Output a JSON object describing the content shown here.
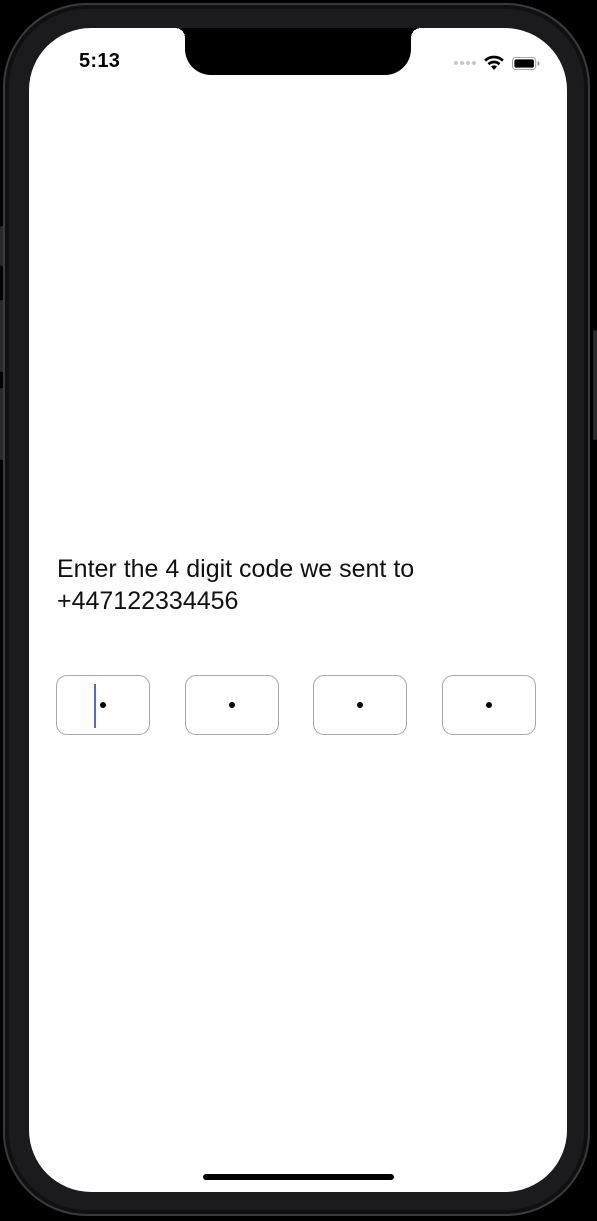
{
  "status_bar": {
    "time": "5:13",
    "icons": [
      "signal-dots-icon",
      "wifi-icon",
      "battery-icon"
    ]
  },
  "verification": {
    "prompt_line1": "Enter the 4 digit code we sent to",
    "phone_number": "+447122334456",
    "code_length": 4,
    "code_placeholder": "•",
    "focused_index": 0
  },
  "colors": {
    "caret": "#4a6bd8",
    "box_border": "#a8a8ad",
    "text": "#111111",
    "background": "#ffffff"
  }
}
